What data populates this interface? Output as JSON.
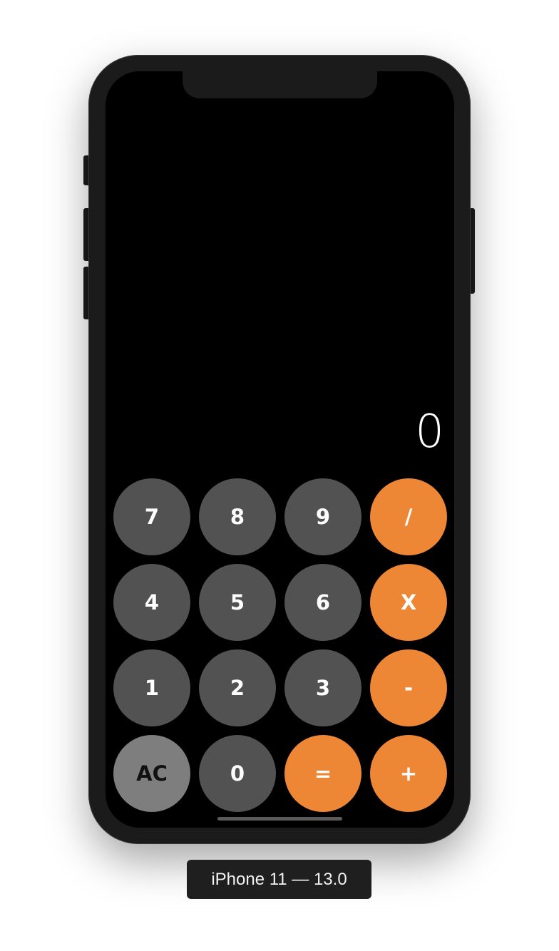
{
  "device": {
    "label": "iPhone 11 — 13.0"
  },
  "calculator": {
    "display": "0",
    "keys": [
      {
        "label": "7",
        "kind": "number"
      },
      {
        "label": "8",
        "kind": "number"
      },
      {
        "label": "9",
        "kind": "number"
      },
      {
        "label": "/",
        "kind": "operator"
      },
      {
        "label": "4",
        "kind": "number"
      },
      {
        "label": "5",
        "kind": "number"
      },
      {
        "label": "6",
        "kind": "number"
      },
      {
        "label": "X",
        "kind": "operator"
      },
      {
        "label": "1",
        "kind": "number"
      },
      {
        "label": "2",
        "kind": "number"
      },
      {
        "label": "3",
        "kind": "number"
      },
      {
        "label": "-",
        "kind": "operator"
      },
      {
        "label": "AC",
        "kind": "function"
      },
      {
        "label": "0",
        "kind": "number"
      },
      {
        "label": "=",
        "kind": "operator"
      },
      {
        "label": "+",
        "kind": "operator"
      }
    ]
  },
  "colors": {
    "number_key": "#525252",
    "operator_key": "#ee8735",
    "function_key": "#7e7e7e",
    "screen_background": "#000000"
  }
}
